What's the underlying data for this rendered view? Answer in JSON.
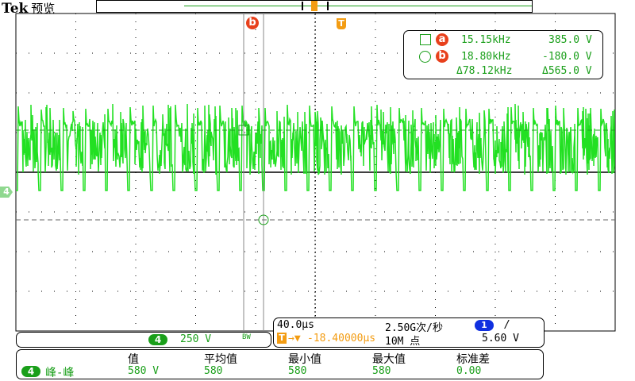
{
  "header": {
    "brand": "Tek",
    "mode": "预览"
  },
  "cursors": {
    "a": {
      "label": "a",
      "time": "15.15kHz",
      "value": "385.0 V"
    },
    "b": {
      "label": "b",
      "time": "18.80kHz",
      "value": "-180.0 V"
    },
    "delta": {
      "time": "Δ78.12kHz",
      "value": "Δ565.0 V"
    }
  },
  "channel": {
    "number": "4",
    "scale": "250 V",
    "bw": "BW",
    "ground_marker": "4"
  },
  "horizontal": {
    "scale": "40.0µs",
    "sample_rate": "2.50G次/秒",
    "trigger_pos": "-18.40000µs",
    "record_length": "10M 点",
    "trigger_source": "1",
    "trigger_slope": "/",
    "trigger_level": "5.60 V",
    "trigger_marker": "T"
  },
  "measurement": {
    "headers": [
      "值",
      "平均值",
      "最小值",
      "最大值",
      "标准差"
    ],
    "source": "4",
    "name": "峰-峰",
    "values": [
      "580 V",
      "580",
      "580",
      "580",
      "0.00"
    ]
  },
  "colors": {
    "trace": "#22e022",
    "cursor": "#e8401c",
    "trigger": "#f39c12",
    "channel": "#1a9f1a",
    "trigger_ch": "#1030e0"
  }
}
